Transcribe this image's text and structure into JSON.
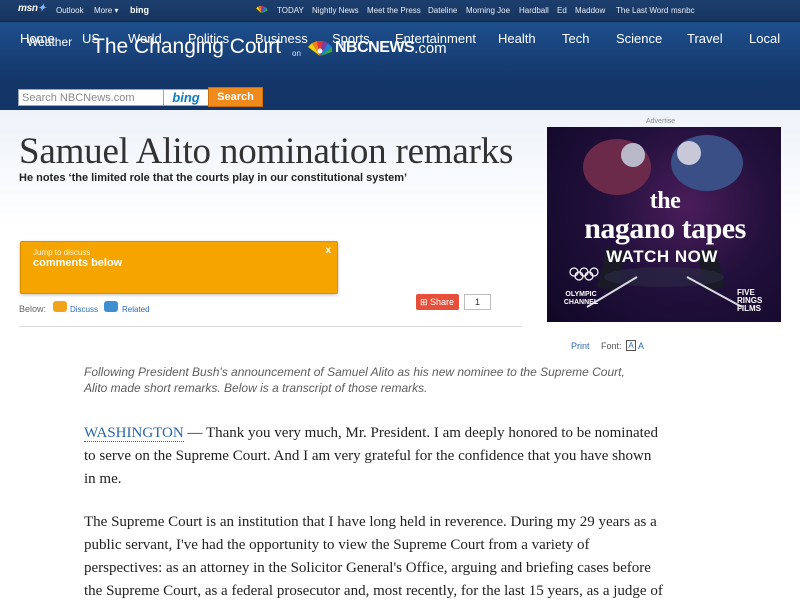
{
  "colors": {
    "top_bar": "#16345e",
    "header": "#1e4f8d",
    "orange": "#f6a500",
    "search_orange": "#f08a1c",
    "link_blue": "#2d6bb3",
    "share_red": "#e84f3a"
  },
  "topbar": {
    "msn_logo": "msn",
    "outlook": "Outlook",
    "more": "More ▾",
    "bing": "bing",
    "links": [
      "TODAY",
      "Nightly News",
      "Meet the Press",
      "Dateline",
      "Morning Joe",
      "Hardball",
      "Ed",
      "Maddow",
      "The Last Word",
      "msnbc"
    ]
  },
  "nav": {
    "items": [
      "Home",
      "US",
      "World",
      "Politics",
      "Business",
      "Sports",
      "Entertainment",
      "Health",
      "Tech",
      "Science",
      "Travel",
      "Local"
    ],
    "weather": "Weather",
    "section_title": "The Changing Court",
    "on": "on",
    "nbc_name": "NBCNEWS",
    "nbc_dot": ".com"
  },
  "search": {
    "placeholder": "Search NBCNews.com",
    "bing": "bing",
    "button": "Search"
  },
  "article": {
    "headline": "Samuel Alito nomination remarks",
    "subhead": "He notes ‘the limited role that the courts play in our constitutional system’",
    "intro": "Following President Bush's announcement of Samuel Alito as his new nominee to the Supreme Court, Alito made short remarks.  Below is a transcript of those remarks.",
    "dateline": "WASHINGTON",
    "para1_rest": " — Thank you very much, Mr. President. I am deeply honored to be nominated to serve on the Supreme Court. And I am very grateful for the confidence that you have shown in me.",
    "para2": "The Supreme Court is an institution that I have long held in reverence. During my 29 years as a public servant, I've had the opportunity to view the Supreme Court from a variety of perspectives: as an attorney in the Solicitor General's Office, arguing and briefing cases before the Supreme Court, as a federal prosecutor and, most recently, for the last 15 years, as a judge of"
  },
  "jump": {
    "small": "Jump to discuss",
    "big": "comments below",
    "close": "x"
  },
  "below": {
    "label": "Below:",
    "discuss": "Discuss",
    "related": "Related"
  },
  "share": {
    "label": "Share",
    "count": "1"
  },
  "tools": {
    "print": "Print",
    "font_label": "Font:",
    "font_a": "A",
    "font_a_small": "A"
  },
  "ad": {
    "label": "Advertise",
    "title_line1": "the",
    "title_line2": "nagano tapes",
    "cta": "WATCH NOW",
    "brand_left": "OLYMPIC CHANNEL",
    "brand_right": "FIVE RINGS FILMS"
  }
}
